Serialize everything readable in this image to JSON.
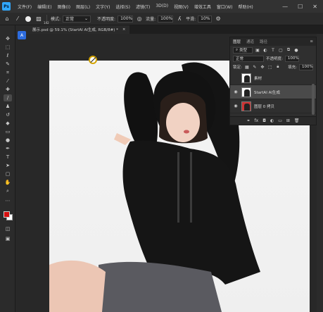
{
  "menubar": {
    "logo": "Ps",
    "items": [
      "文件(F)",
      "编辑(E)",
      "图像(I)",
      "图层(L)",
      "文字(Y)",
      "选择(S)",
      "滤镜(T)",
      "3D(D)",
      "视图(V)",
      "增效工具",
      "窗口(W)",
      "帮助(H)"
    ],
    "window_controls": [
      "—",
      "☐",
      "✕"
    ]
  },
  "options": {
    "brush_size": "142",
    "mode_label": "模式:",
    "mode_value": "正常",
    "opacity_label": "不透明度:",
    "opacity_value": "100%",
    "flow_label": "流量:",
    "flow_value": "100%",
    "smooth_label": "平滑:",
    "smooth_value": "10%"
  },
  "document": {
    "tab_title": "展示.psd @ 59.1% (StartAI AI生成, RGB/8#) *",
    "close": "×"
  },
  "toolbar": {
    "tools": [
      "move-tool",
      "artboard-tool",
      "lasso-tool",
      "quick-select-tool",
      "crop-tool",
      "eyedropper-tool",
      "healing-tool",
      "brush-tool",
      "stamp-tool",
      "history-brush-tool",
      "eraser-tool",
      "gradient-tool",
      "dodge-tool",
      "pen-tool",
      "type-tool",
      "path-select-tool",
      "rectangle-tool",
      "hand-tool",
      "zoom-tool",
      "more-tool"
    ],
    "fg_color": "#d40e0e",
    "bg_color": "#ffffff"
  },
  "layers": {
    "tabs": [
      "图层",
      "通道",
      "路径"
    ],
    "filter_label": "类型",
    "blend_mode": "正常",
    "opacity_label": "不透明度:",
    "opacity_value": "100%",
    "lock_label": "锁定:",
    "fill_label": "填充:",
    "fill_value": "100%",
    "items": [
      {
        "name": "素材",
        "visible": false,
        "selected": false
      },
      {
        "name": "StartAI AI生成",
        "visible": true,
        "selected": true
      },
      {
        "name": "图层 0 拷贝",
        "visible": true,
        "selected": false
      }
    ]
  }
}
